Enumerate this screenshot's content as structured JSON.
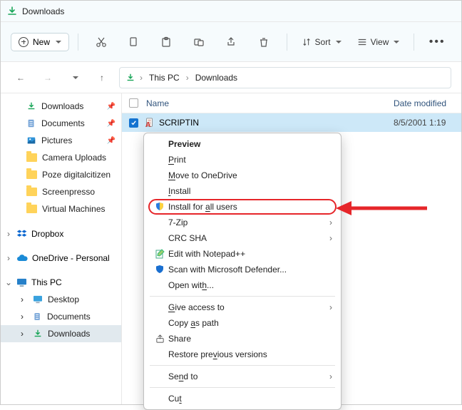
{
  "titlebar": {
    "title": "Downloads"
  },
  "toolbar": {
    "new_label": "New",
    "sort_label": "Sort",
    "view_label": "View"
  },
  "breadcrumb": {
    "root": "This PC",
    "current": "Downloads"
  },
  "sidebar": {
    "quick": [
      {
        "label": "Downloads",
        "icon": "download",
        "pinned": true
      },
      {
        "label": "Documents",
        "icon": "doc",
        "pinned": true
      },
      {
        "label": "Pictures",
        "icon": "picture",
        "pinned": true
      },
      {
        "label": "Camera Uploads",
        "icon": "folder",
        "pinned": false
      },
      {
        "label": "Poze digitalcitizen",
        "icon": "folder",
        "pinned": false
      },
      {
        "label": "Screenpresso",
        "icon": "folder",
        "pinned": false
      },
      {
        "label": "Virtual Machines",
        "icon": "folder",
        "pinned": false
      }
    ],
    "dropbox": "Dropbox",
    "onedrive": "OneDrive - Personal",
    "thispc": "This PC",
    "thispc_children": [
      {
        "label": "Desktop"
      },
      {
        "label": "Documents"
      },
      {
        "label": "Downloads"
      }
    ]
  },
  "columns": {
    "name": "Name",
    "date": "Date modified"
  },
  "row": {
    "filename": "SCRIPTIN",
    "date": "8/5/2001 1:19"
  },
  "context_menu": {
    "preview": "Preview",
    "print": "Print",
    "move_onedrive": "Move to OneDrive",
    "install": "Install",
    "install_all": "Install for all users",
    "sevenzip": "7-Zip",
    "crcsha": "CRC SHA",
    "edit_npp": "Edit with Notepad++",
    "scan_defender": "Scan with Microsoft Defender...",
    "open_with": "Open with...",
    "give_access": "Give access to",
    "copy_as_path": "Copy as path",
    "share": "Share",
    "restore": "Restore previous versions",
    "send_to": "Send to",
    "cut": "Cut"
  }
}
